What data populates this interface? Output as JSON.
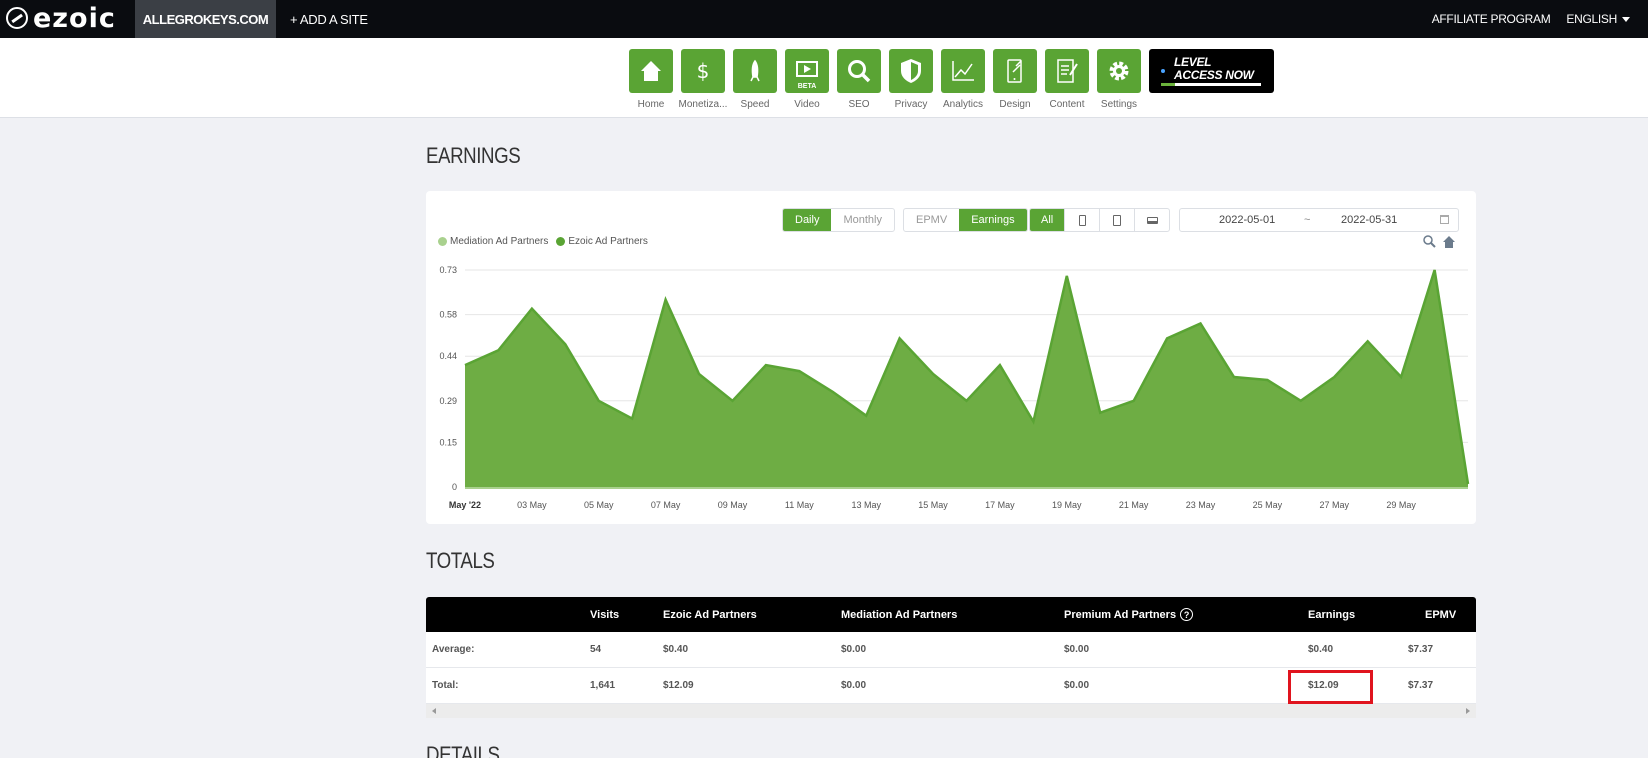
{
  "topbar": {
    "logo_text": "ezoic",
    "site_name": "ALLEGROKEYS.COM",
    "add_site": "+ ADD A SITE",
    "affiliate": "AFFILIATE PROGRAM",
    "language": "ENGLISH"
  },
  "nav": {
    "items": [
      {
        "label": "Home",
        "icon": "home-icon"
      },
      {
        "label": "Monetiza...",
        "icon": "dollar-icon"
      },
      {
        "label": "Speed",
        "icon": "rocket-icon"
      },
      {
        "label": "Video",
        "icon": "video-icon",
        "badge": "BETA"
      },
      {
        "label": "SEO",
        "icon": "magnifier-icon"
      },
      {
        "label": "Privacy",
        "icon": "shield-icon"
      },
      {
        "label": "Analytics",
        "icon": "line-chart-icon"
      },
      {
        "label": "Design",
        "icon": "design-icon"
      },
      {
        "label": "Content",
        "icon": "document-icon"
      },
      {
        "label": "Settings",
        "icon": "gear-icon"
      }
    ],
    "level_line1": "LEVEL",
    "level_line2": "ACCESS NOW"
  },
  "earnings": {
    "title": "EARNINGS",
    "period_buttons": [
      "Daily",
      "Monthly"
    ],
    "period_active": "Daily",
    "metric_buttons": [
      "EPMV",
      "Earnings"
    ],
    "metric_active": "Earnings",
    "device_all": "All",
    "device_icons": [
      "mobile-icon",
      "tablet-icon",
      "desktop-icon"
    ],
    "date_from": "2022-05-01",
    "date_sep": "~",
    "date_to": "2022-05-31",
    "legend": [
      {
        "name": "Mediation Ad Partners",
        "color": "#a9d18e"
      },
      {
        "name": "Ezoic Ad Partners",
        "color": "#5aa434"
      }
    ]
  },
  "chart_data": {
    "type": "area",
    "title": "",
    "xlabel": "",
    "ylabel": "",
    "ylim": [
      0,
      0.73
    ],
    "y_ticks": [
      "0.73",
      "0.58",
      "0.44",
      "0.29",
      "0.15",
      "0"
    ],
    "x_tick_labels": [
      "May '22",
      "03 May",
      "05 May",
      "07 May",
      "09 May",
      "11 May",
      "13 May",
      "15 May",
      "17 May",
      "19 May",
      "21 May",
      "23 May",
      "25 May",
      "27 May",
      "29 May"
    ],
    "x": [
      "2022-05-01",
      "2022-05-02",
      "2022-05-03",
      "2022-05-04",
      "2022-05-05",
      "2022-05-06",
      "2022-05-07",
      "2022-05-08",
      "2022-05-09",
      "2022-05-10",
      "2022-05-11",
      "2022-05-12",
      "2022-05-13",
      "2022-05-14",
      "2022-05-15",
      "2022-05-16",
      "2022-05-17",
      "2022-05-18",
      "2022-05-19",
      "2022-05-20",
      "2022-05-21",
      "2022-05-22",
      "2022-05-23",
      "2022-05-24",
      "2022-05-25",
      "2022-05-26",
      "2022-05-27",
      "2022-05-28",
      "2022-05-29",
      "2022-05-30",
      "2022-05-31"
    ],
    "series": [
      {
        "name": "Mediation Ad Partners",
        "color": "#a9d18e",
        "values": [
          0,
          0,
          0,
          0,
          0,
          0,
          0,
          0,
          0,
          0,
          0,
          0,
          0,
          0,
          0,
          0,
          0,
          0,
          0,
          0,
          0,
          0,
          0,
          0,
          0,
          0,
          0,
          0,
          0,
          0,
          0
        ]
      },
      {
        "name": "Ezoic Ad Partners",
        "color": "#5aa434",
        "values": [
          0.41,
          0.46,
          0.6,
          0.48,
          0.29,
          0.23,
          0.63,
          0.38,
          0.29,
          0.41,
          0.39,
          0.32,
          0.24,
          0.5,
          0.38,
          0.29,
          0.41,
          0.22,
          0.71,
          0.25,
          0.29,
          0.5,
          0.55,
          0.37,
          0.36,
          0.29,
          0.37,
          0.49,
          0.37,
          0.73,
          0.01
        ]
      }
    ],
    "grid": true,
    "legend_position": "top-left"
  },
  "totals": {
    "title": "TOTALS",
    "columns": [
      "",
      "Visits",
      "Ezoic Ad Partners",
      "Mediation Ad Partners",
      "Premium Ad Partners",
      "Earnings",
      "EPMV"
    ],
    "rows": [
      {
        "label": "Average:",
        "values": [
          "54",
          "$0.40",
          "$0.00",
          "$0.00",
          "$0.40",
          "$7.37"
        ]
      },
      {
        "label": "Total:",
        "values": [
          "1,641",
          "$12.09",
          "$0.00",
          "$0.00",
          "$12.09",
          "$7.37"
        ]
      }
    ],
    "help_glyph": "?"
  },
  "details": {
    "title": "DETAILS"
  }
}
